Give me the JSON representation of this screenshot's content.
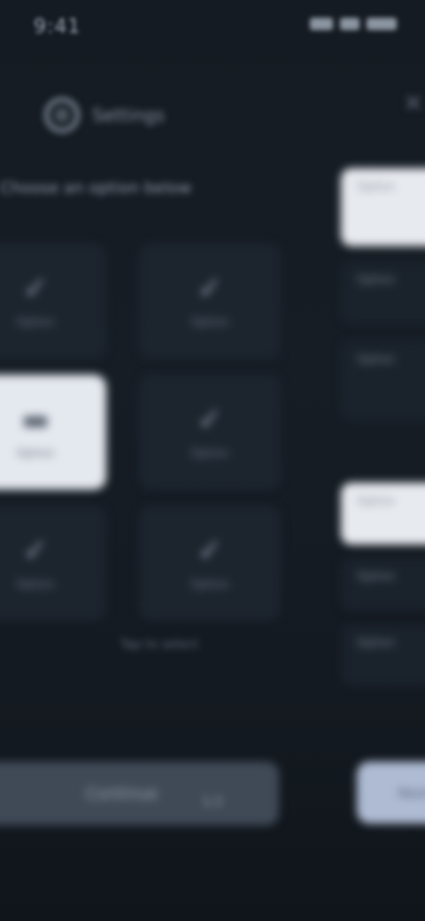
{
  "status_bar": {
    "time": "9:41"
  },
  "left_panel": {
    "header_label": "Settings",
    "subtitle": "Choose an option below",
    "tiles": [
      {
        "icon": "✓",
        "label": "Option"
      },
      {
        "icon": "✓",
        "label": "Option"
      },
      {
        "icon": "▬",
        "label": "Option"
      },
      {
        "icon": "✓",
        "label": "Option"
      },
      {
        "icon": "✓",
        "label": "Option"
      },
      {
        "icon": "✓",
        "label": "Option"
      }
    ],
    "hint": "Tap to select",
    "primary_button": "Continue",
    "page_indicator": "1/2"
  },
  "right_panel": {
    "cards": [
      {
        "text": "Option"
      },
      {
        "text": "Option"
      },
      {
        "text": "Option"
      },
      {
        "text": "Option"
      },
      {
        "text": "Option"
      },
      {
        "text": "Option"
      }
    ],
    "button": "Next"
  }
}
